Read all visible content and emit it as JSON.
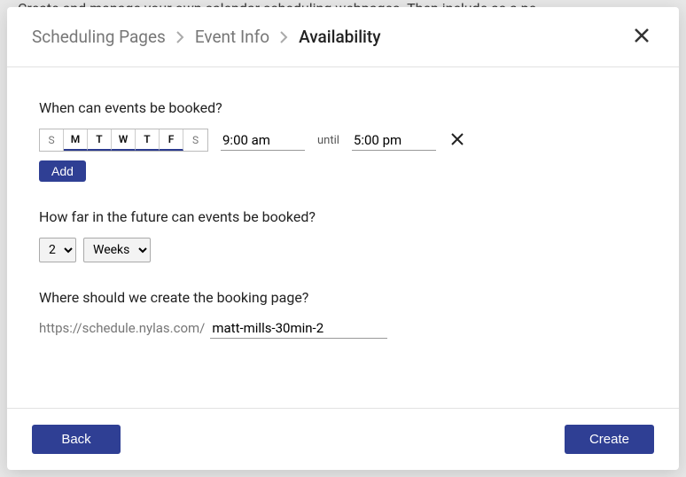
{
  "background_text": "Create and manage your own calendar scheduling webpages. Then include as a pe",
  "breadcrumb": {
    "items": [
      "Scheduling Pages",
      "Event Info"
    ],
    "current": "Availability"
  },
  "section_booked_label": "When can events be booked?",
  "days": [
    {
      "abbr": "S",
      "selected": false
    },
    {
      "abbr": "M",
      "selected": true
    },
    {
      "abbr": "T",
      "selected": true
    },
    {
      "abbr": "W",
      "selected": true
    },
    {
      "abbr": "T",
      "selected": true
    },
    {
      "abbr": "F",
      "selected": true
    },
    {
      "abbr": "S",
      "selected": false
    }
  ],
  "time_start": "9:00 am",
  "until_label": "until",
  "time_end": "5:00 pm",
  "add_label": "Add",
  "section_future_label": "How far in the future can events be booked?",
  "future_count": "2",
  "future_unit": "Weeks",
  "section_url_label": "Where should we create the booking page?",
  "url_prefix": "https://schedule.nylas.com/",
  "url_slug": "matt-mills-30min-2",
  "footer": {
    "back": "Back",
    "create": "Create"
  }
}
